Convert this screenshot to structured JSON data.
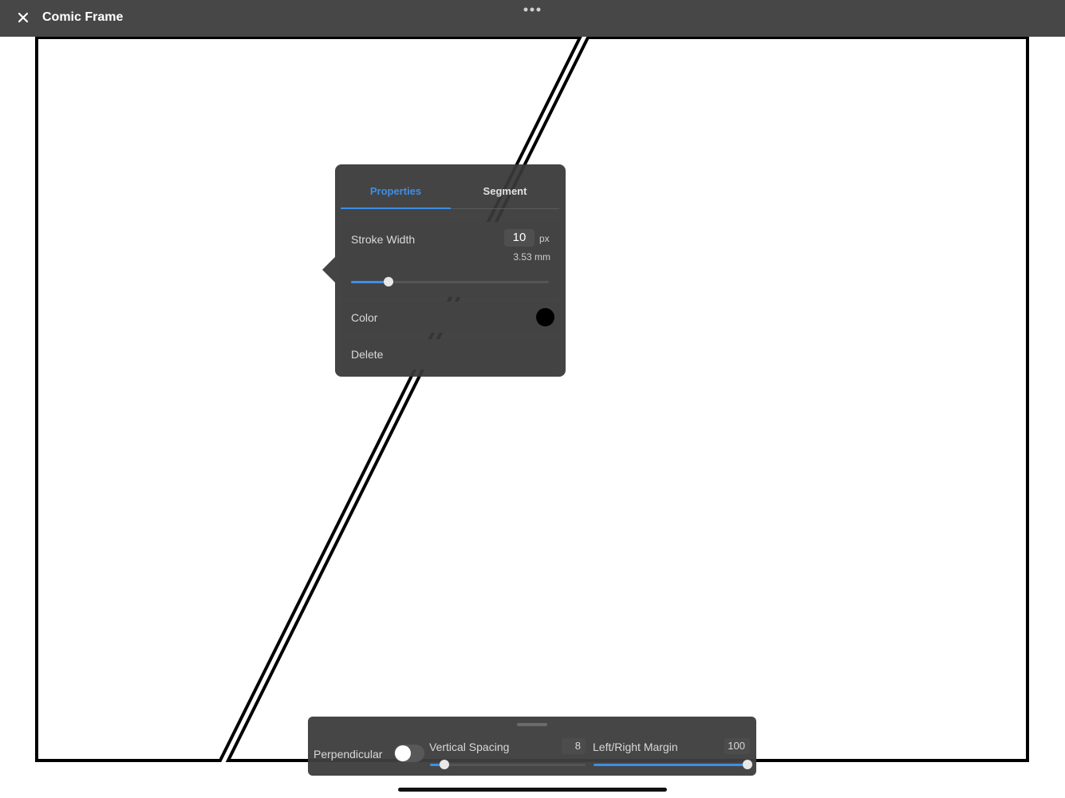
{
  "window": {
    "title": "Comic Frame",
    "close_icon": "close-icon",
    "more_icon": "more-dots-icon"
  },
  "popover": {
    "tabs": [
      {
        "label": "Properties",
        "active": true
      },
      {
        "label": "Segment",
        "active": false
      }
    ],
    "stroke_width": {
      "label": "Stroke Width",
      "value": "10",
      "unit": "px",
      "mm": "3.53 mm",
      "slider_fraction": 0.19
    },
    "color": {
      "label": "Color",
      "value": "#000000"
    },
    "delete_label": "Delete"
  },
  "bottom_panel": {
    "perpendicular_label": "Perpendicular",
    "perpendicular_on": false,
    "vertical_spacing": {
      "label": "Vertical Spacing",
      "value": "8",
      "slider_fraction": 0.09
    },
    "margin": {
      "label": "Left/Right Margin",
      "value": "100",
      "slider_fraction": 1.0
    }
  },
  "colors": {
    "accent": "#3d8fe6",
    "toolbar": "#474747",
    "panel": "#383838"
  }
}
